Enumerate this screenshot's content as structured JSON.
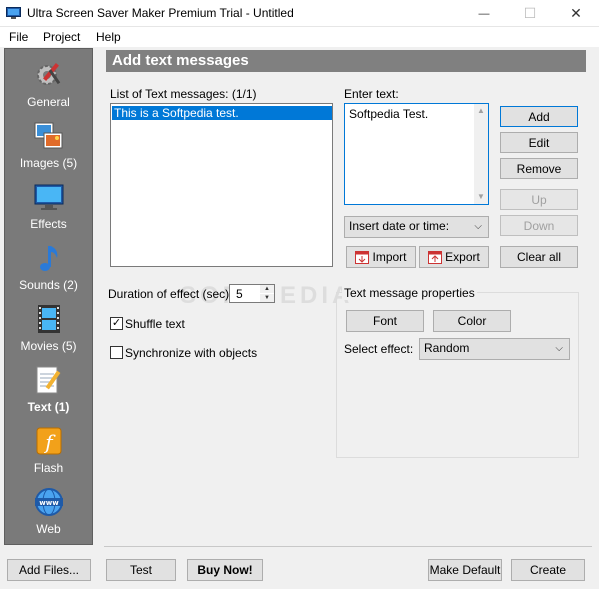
{
  "window": {
    "title": "Ultra Screen Saver Maker Premium Trial - Untitled",
    "minimize": "—",
    "maximize": "☐",
    "close": "✕"
  },
  "menu": {
    "file": "File",
    "project": "Project",
    "help": "Help"
  },
  "sidebar": {
    "items": [
      {
        "label": "General",
        "icon": "gear-tools-icon"
      },
      {
        "label": "Images (5)",
        "icon": "images-icon"
      },
      {
        "label": "Effects",
        "icon": "monitor-icon"
      },
      {
        "label": "Sounds (2)",
        "icon": "music-note-icon"
      },
      {
        "label": "Movies (5)",
        "icon": "film-icon"
      },
      {
        "label": "Text (1)",
        "icon": "notepad-pencil-icon",
        "active": true
      },
      {
        "label": "Flash",
        "icon": "flash-icon"
      },
      {
        "label": "Web",
        "icon": "www-globe-icon"
      }
    ]
  },
  "panel": {
    "title": "Add text messages",
    "list_label": "List of Text messages: (1/1)",
    "messages": [
      "This is a Softpedia test."
    ],
    "enter_text_label": "Enter text:",
    "enter_text_value": "Softpedia Test.",
    "buttons": {
      "add": "Add",
      "edit": "Edit",
      "remove": "Remove",
      "up": "Up",
      "down": "Down",
      "import": "Import",
      "export": "Export",
      "clear_all": "Clear all"
    },
    "insert_date_select": "Insert date or time:",
    "duration_label": "Duration of effect (sec):",
    "duration_value": "5",
    "shuffle_label": "Shuffle text",
    "shuffle_checked": true,
    "sync_label": "Synchronize with objects",
    "sync_checked": false,
    "props_title": "Text message properties",
    "font_button": "Font",
    "color_button": "Color",
    "select_effect_label": "Select effect:",
    "select_effect_value": "Random"
  },
  "watermark": "SOFTPEDIA",
  "footer": {
    "add_files": "Add Files...",
    "test": "Test",
    "buy_now": "Buy Now!",
    "make_default": "Make Default",
    "create": "Create"
  },
  "colors": {
    "selection": "#0078d7",
    "sidebar_bg": "#7a7a7a",
    "header_bg": "#808080"
  }
}
